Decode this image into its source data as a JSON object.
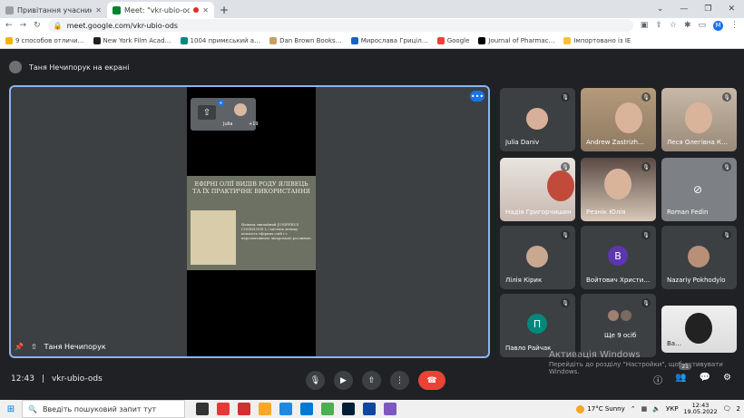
{
  "browser": {
    "tabs": [
      {
        "label": "Привітання учасникам студент…",
        "active": false
      },
      {
        "label": "Meet: \"vkr-ubio-ods\"",
        "active": true
      }
    ],
    "url": "meet.google.com/vkr-ubio-ods",
    "profile_initial": "M",
    "bookmarks": [
      "9 способов отличи…",
      "New York Film Acad…",
      "1004 примєський а…",
      "Dan Brown Books…",
      "Мирослава Гриціл…",
      "Google",
      "Journal of Pharmac…",
      "Імпортовано із IE"
    ]
  },
  "meet": {
    "presenting_label": "Таня Нечипорук на екрані",
    "stage_name": "Таня Нечипорук",
    "mini_tile_name": "Julia",
    "mini_tile_count": "+19",
    "slide": {
      "title": "ЕФІРНІ ОЛІЇ ВИДІВ РОДУ ЯЛІВЕЦЬ ТА ЇХ ПРАКТИЧНЕ ВИКОРИСТАННЯ",
      "body": "Ялівець звичайний JUNIPERUS COMMUNIS L.) містить велику кількість ефірних олій і є перспективною лікарською рослиною."
    },
    "participants": [
      {
        "name": "Julia Daniv"
      },
      {
        "name": "Andrew Zastrizh…"
      },
      {
        "name": "Леся Олегівна К…"
      },
      {
        "name": "Надія Григорчишин"
      },
      {
        "name": "Резнік Юлія"
      },
      {
        "name": "Roman Fedin"
      },
      {
        "name": "Лілія Кірик"
      },
      {
        "name": "Войтович Христи…",
        "initial": "В"
      },
      {
        "name": "Nazariy Pokhodylo"
      },
      {
        "name": "Павло Райчак",
        "initial": "П"
      },
      {
        "name": "Ще 9 осіб"
      },
      {
        "name": "Ва…"
      }
    ],
    "meeting_time": "12:43",
    "meeting_code": "vkr-ubio-ods",
    "people_count": "21"
  },
  "watermark": {
    "title": "Активація Windows",
    "line1": "Перейдіть до розділу \"Настройки\", щоб активувати",
    "line2": "Windows."
  },
  "taskbar": {
    "search_placeholder": "Введіть пошуковий запит тут",
    "weather": "17°C Sunny",
    "lang": "УКР",
    "time": "12:43",
    "date": "19.05.2022",
    "notif_count": "2"
  }
}
